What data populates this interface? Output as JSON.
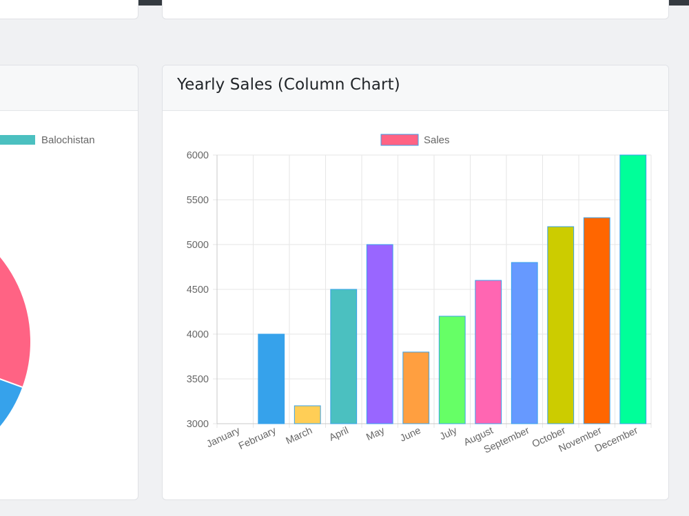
{
  "pie_card": {
    "legend_label": "Balochistan",
    "legend_color": "#4bc0c0"
  },
  "bar_card": {
    "title": "Yearly Sales (Column Chart)"
  },
  "chart_data": [
    {
      "type": "pie",
      "title": "",
      "legend": [
        "Balochistan"
      ],
      "visible_slices": [
        {
          "color": "#ff6384"
        },
        {
          "color": "#36a2eb"
        }
      ],
      "note_colors": {
        "balochistan": "#4bc0c0"
      }
    },
    {
      "type": "bar",
      "title": "Yearly Sales (Column Chart)",
      "categories": [
        "January",
        "February",
        "March",
        "April",
        "May",
        "June",
        "July",
        "August",
        "September",
        "October",
        "November",
        "December"
      ],
      "series": [
        {
          "name": "Sales",
          "values": [
            3000,
            4000,
            3200,
            4500,
            5000,
            3800,
            4200,
            4600,
            4800,
            5200,
            5300,
            6000
          ],
          "colors": [
            "#ff6384",
            "#36a2eb",
            "#ffce56",
            "#4bc0c0",
            "#9966ff",
            "#ff9f40",
            "#66ff66",
            "#ff66b2",
            "#6699ff",
            "#cccc00",
            "#ff6600",
            "#00ff99"
          ]
        }
      ],
      "yticks": [
        3000,
        3500,
        4000,
        4500,
        5000,
        5500,
        6000
      ],
      "ylim": [
        3000,
        6000
      ],
      "grid": true,
      "legend_position": "top",
      "legend_color": "#ff6384",
      "bar_border_color": "#36a2eb"
    }
  ]
}
